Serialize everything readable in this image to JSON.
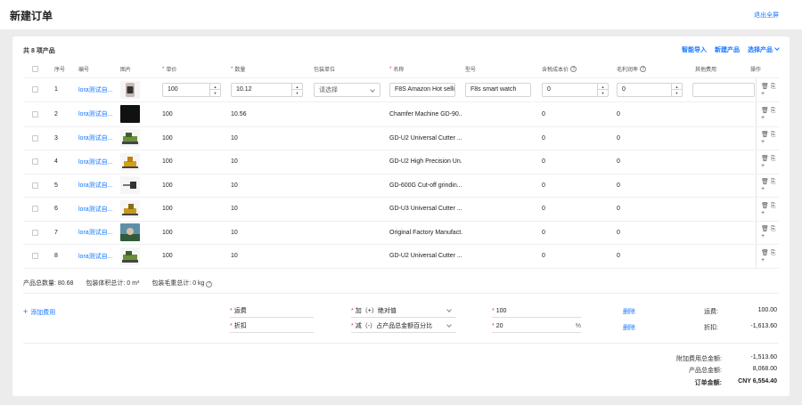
{
  "header": {
    "title": "新建订单",
    "exit_fullscreen": "退出全屏"
  },
  "products": {
    "count_label": "共 8 项产品",
    "actions": {
      "smart_import": "智能导入",
      "new_product": "新建产品",
      "select_product": "选择产品"
    },
    "columns": {
      "seq": "序号",
      "code": "编号",
      "image": "图片",
      "unit_price": "单价",
      "quantity": "数量",
      "pack_unit": "包装单位",
      "name": "名称",
      "model": "型号",
      "cost_price": "含税成本价",
      "margin": "毛利润率",
      "other_cost": "其他费用",
      "operations": "操作"
    },
    "editable_row": {
      "seq": "1",
      "code": "lora测试自...",
      "unit_price": "100",
      "quantity": "10.12",
      "pack_unit_placeholder": "请选择",
      "name": "F8S Amazon Hot selli",
      "model": "F8s smart watch",
      "cost_price": "0",
      "margin": "0",
      "other_cost": ""
    },
    "rows": [
      {
        "seq": "2",
        "code": "lora测试自...",
        "unit_price": "100",
        "quantity": "10.56",
        "name": "Chamfer Machine GD-90...",
        "cost_price": "0",
        "margin": "0"
      },
      {
        "seq": "3",
        "code": "lora测试自...",
        "unit_price": "100",
        "quantity": "10",
        "name": "GD-U2 Universal Cutter ...",
        "cost_price": "0",
        "margin": "0"
      },
      {
        "seq": "4",
        "code": "lora测试自...",
        "unit_price": "100",
        "quantity": "10",
        "name": "GD-U2 High Precision Un...",
        "cost_price": "0",
        "margin": "0"
      },
      {
        "seq": "5",
        "code": "lora测试自...",
        "unit_price": "100",
        "quantity": "10",
        "name": "GD-600G Cut-off grindin...",
        "cost_price": "0",
        "margin": "0"
      },
      {
        "seq": "6",
        "code": "lora测试自...",
        "unit_price": "100",
        "quantity": "10",
        "name": "GD-U3 Universal Cutter ...",
        "cost_price": "0",
        "margin": "0"
      },
      {
        "seq": "7",
        "code": "lora测试自...",
        "unit_price": "100",
        "quantity": "10",
        "name": "Original Factory Manufact...",
        "cost_price": "0",
        "margin": "0"
      },
      {
        "seq": "8",
        "code": "lora测试自...",
        "unit_price": "100",
        "quantity": "10",
        "name": "GD-U2 Universal Cutter ...",
        "cost_price": "0",
        "margin": "0"
      }
    ],
    "op_icons": "🗑 ⎘ +"
  },
  "summary": {
    "total_qty": "产品总数量: 80.68",
    "total_volume": "包装体积总计: 0 m³",
    "total_weight": "包装毛重总计: 0 kg"
  },
  "fees": {
    "add_label": "添加费用",
    "items": [
      {
        "name": "运费",
        "type": "加（+）绝对值",
        "value": "100",
        "unit": "",
        "delete": "删除",
        "label": "运费:",
        "amount": "100.00"
      },
      {
        "name": "折扣",
        "type": "减（-）占产品总金额百分比",
        "value": "20",
        "unit": "%",
        "delete": "删除",
        "label": "折扣:",
        "amount": "-1,613.60"
      }
    ]
  },
  "totals": {
    "extra_label": "附加费用总金额:",
    "extra_value": "-1,513.60",
    "product_label": "产品总金额:",
    "product_value": "8,068.00",
    "order_label": "订单金额:",
    "order_value": "CNY 6,554.40"
  }
}
